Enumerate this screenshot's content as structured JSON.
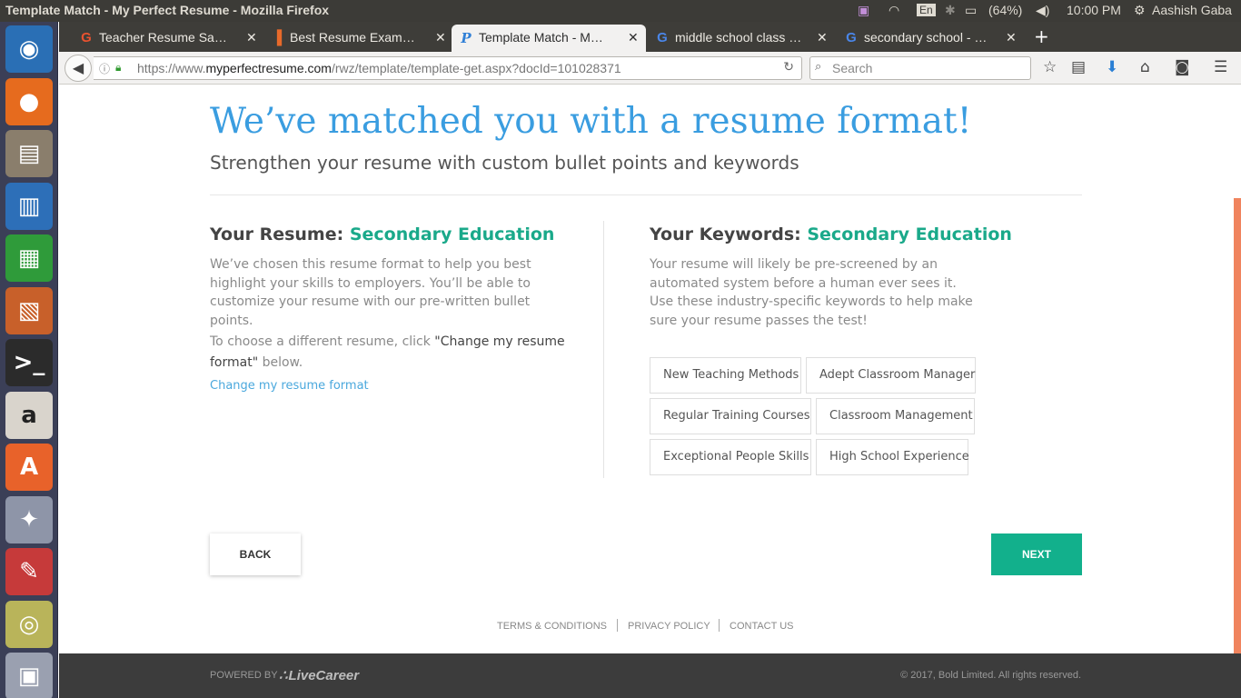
{
  "system": {
    "window_title": "Template Match - My Perfect Resume - Mozilla Firefox",
    "keyboard_layout": "En",
    "battery": "(64%)",
    "clock": "10:00 PM",
    "user": "Aashish Gaba"
  },
  "launcher": {
    "items": [
      {
        "name": "ubuntu-dash-icon",
        "glyph": "◉",
        "color": "#2a6fb5"
      },
      {
        "name": "firefox-icon",
        "glyph": "●",
        "color": "#e66b1e"
      },
      {
        "name": "files-icon",
        "glyph": "▤",
        "color": "#8a7e6c"
      },
      {
        "name": "libreoffice-writer-icon",
        "glyph": "▥",
        "color": "#2d6fb8"
      },
      {
        "name": "libreoffice-calc-icon",
        "glyph": "▦",
        "color": "#2f9b3a"
      },
      {
        "name": "libreoffice-impress-icon",
        "glyph": "▧",
        "color": "#c8602a"
      },
      {
        "name": "terminal-icon",
        "glyph": ">_",
        "color": "#2b2b2b"
      },
      {
        "name": "amazon-icon",
        "glyph": "a",
        "color": "#d9d4cc"
      },
      {
        "name": "software-center-icon",
        "glyph": "A",
        "color": "#e8622a"
      },
      {
        "name": "system-settings-icon",
        "glyph": "✦",
        "color": "#8e95a8"
      },
      {
        "name": "document-viewer-icon",
        "glyph": "✎",
        "color": "#c63a3a"
      },
      {
        "name": "disk-icon",
        "glyph": "◎",
        "color": "#b9b45a"
      },
      {
        "name": "workspace-switcher-icon",
        "glyph": "▣",
        "color": "#9aa0b0"
      }
    ]
  },
  "tabs": [
    {
      "title": "Teacher Resume Sa…",
      "favicon": "G",
      "favicon_color": "#e8522f",
      "active": false
    },
    {
      "title": "Best Resume Exam…",
      "favicon": "▐",
      "favicon_color": "#e86a2a",
      "active": false
    },
    {
      "title": "Template Match - M…",
      "favicon": "P",
      "favicon_color": "#2f7fd6",
      "active": true
    },
    {
      "title": "middle school class …",
      "favicon": "G",
      "favicon_color": "#4a86e8",
      "active": false
    },
    {
      "title": "secondary school - …",
      "favicon": "G",
      "favicon_color": "#4a86e8",
      "active": false
    }
  ],
  "navbar": {
    "url_prefix": "https://www.",
    "url_domain": "myperfectresume.com",
    "url_path": "/rwz/template/template-get.aspx?docId=101028371",
    "search_placeholder": "Search"
  },
  "page": {
    "headline": "We’ve matched you with a resume format!",
    "subheadline": "Strengthen your resume with custom bullet points and keywords",
    "resume": {
      "heading_prefix": "Your Resume:",
      "heading_accent": "Secondary Education",
      "description": "We’ve chosen this resume format to help you best highlight your skills to employers. You’ll be able to customize your resume with our pre-written bullet points.",
      "choose_prefix": "To choose a different resume, click ",
      "choose_emphasis": "\"Change my resume format\"",
      "choose_suffix": " below.",
      "change_link": "Change my resume format"
    },
    "keywords": {
      "heading_prefix": "Your Keywords:",
      "heading_accent": "Secondary Education",
      "description_1": "Your resume will likely be pre-screened by an automated system before a human ever sees it.",
      "description_2": "Use these industry-specific keywords to help make sure your resume passes the test!",
      "items": [
        "New Teaching Methods",
        "Adept Classroom Manager",
        "Regular Training Courses",
        "Classroom Management",
        "Exceptional People Skills",
        "High School Experience"
      ]
    },
    "back_label": "BACK",
    "next_label": "NEXT",
    "footer_links": [
      "TERMS & CONDITIONS",
      "PRIVACY POLICY",
      "CONTACT US"
    ],
    "powered_by": "POWERED BY",
    "brand": "LiveCareer",
    "copyright": "© 2017, Bold Limited. All rights reserved.",
    "colors": {
      "headline": "#3a9de0",
      "accent": "#1aa98a",
      "next_button": "#12b08c",
      "link": "#4aa8dd",
      "scrollbar": "#f0845e"
    }
  }
}
